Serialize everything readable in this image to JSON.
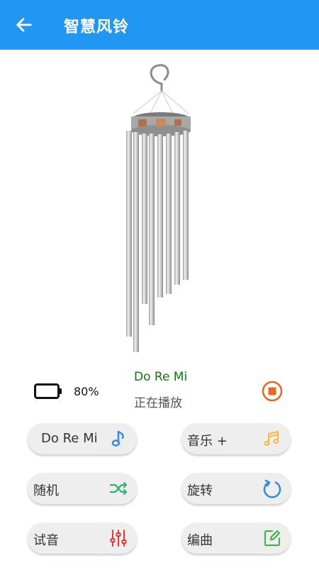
{
  "app_bar": {
    "title": "智慧风铃",
    "back_icon": "arrow-left-icon",
    "color": "#2196f3"
  },
  "image": {
    "subject": "wind-chime-image"
  },
  "status": {
    "battery_icon": "battery-icon",
    "battery_percent": "80%",
    "song_name": "Do Re Mi",
    "play_state": "正在播放",
    "stop_icon": "stop-icon"
  },
  "buttons": [
    {
      "label": "Do Re Mi",
      "icon": "music-note-icon",
      "icon_color": "#3b8fe0"
    },
    {
      "label": "音乐 +",
      "icon": "music-notes-icon",
      "icon_color": "#f5b942"
    },
    {
      "label": "随机",
      "icon": "shuffle-icon",
      "icon_color": "#2fb36a"
    },
    {
      "label": "旋转",
      "icon": "rotate-icon",
      "icon_color": "#2f8fe0"
    },
    {
      "label": "试音",
      "icon": "equalizer-icon",
      "icon_color": "#e53935"
    },
    {
      "label": "编曲",
      "icon": "edit-icon",
      "icon_color": "#4caf50"
    }
  ]
}
